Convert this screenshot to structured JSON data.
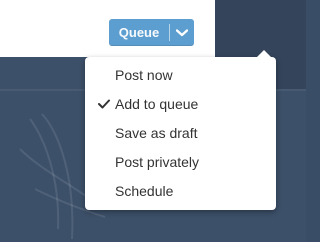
{
  "queue_button": {
    "label": "Queue"
  },
  "menu": {
    "items": [
      {
        "label": "Post now",
        "checked": false
      },
      {
        "label": "Add to queue",
        "checked": true
      },
      {
        "label": "Save as draft",
        "checked": false
      },
      {
        "label": "Post privately",
        "checked": false
      },
      {
        "label": "Schedule",
        "checked": false
      }
    ]
  },
  "icons": {
    "caret": "chevron-down-icon",
    "check": "checkmark-icon"
  },
  "colors": {
    "button": "#5d9ed0",
    "background": "#3a4d66",
    "menu_bg": "#ffffff",
    "menu_text": "#333333"
  }
}
